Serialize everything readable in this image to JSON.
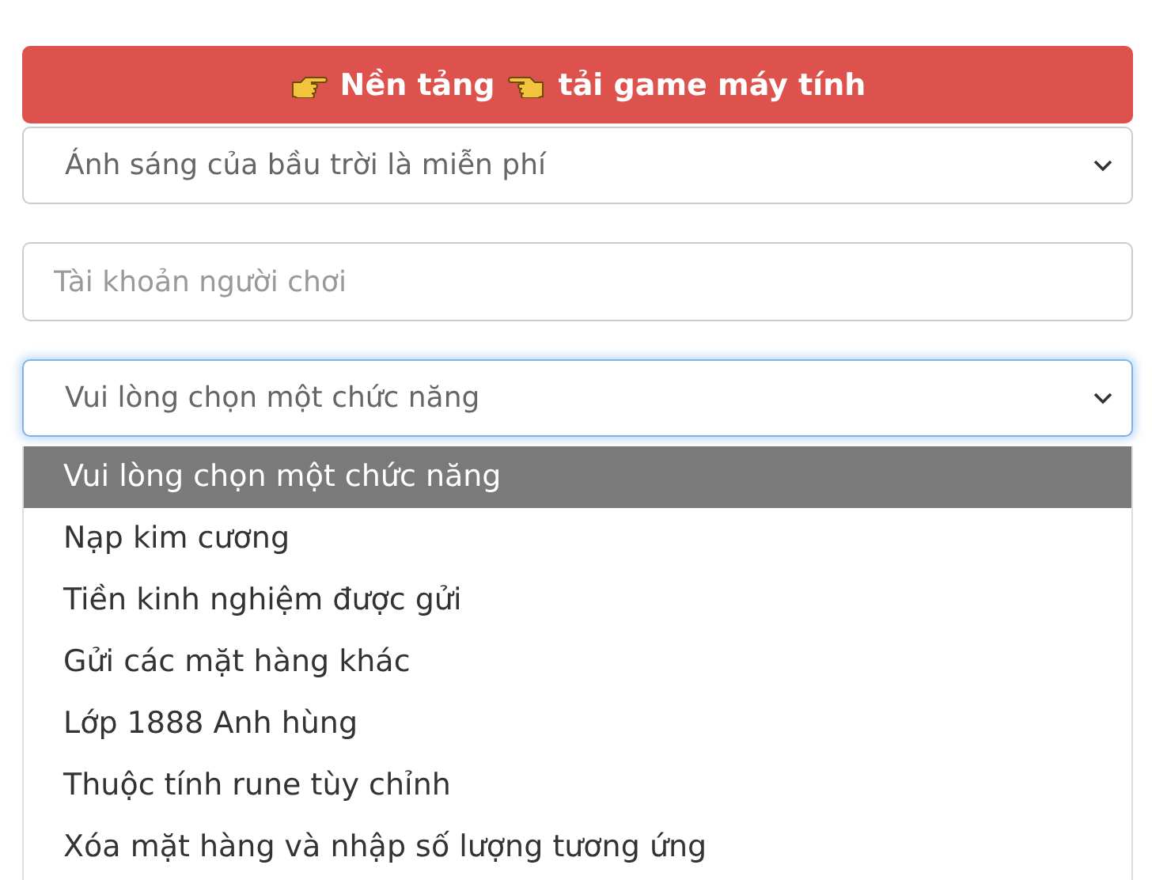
{
  "banner": {
    "text_before": "Nền tảng",
    "text_after": "tải game máy tính"
  },
  "server_select": {
    "value": "Ánh sáng của bầu trời là miễn phí"
  },
  "account_field": {
    "placeholder": "Tài khoản người chơi"
  },
  "function_select": {
    "value": "Vui lòng chọn một chức năng",
    "focused": true,
    "expanded": true,
    "options": [
      {
        "label": "Vui lòng chọn một chức năng",
        "selected": true
      },
      {
        "label": "Nạp kim cương",
        "selected": false
      },
      {
        "label": "Tiền kinh nghiệm được gửi",
        "selected": false
      },
      {
        "label": "Gửi các mặt hàng khác",
        "selected": false
      },
      {
        "label": "Lớp 1888 Anh hùng",
        "selected": false
      },
      {
        "label": "Thuộc tính rune tùy chỉnh",
        "selected": false
      },
      {
        "label": "Xóa mặt hàng và nhập số lượng tương ứng",
        "selected": false
      }
    ]
  }
}
